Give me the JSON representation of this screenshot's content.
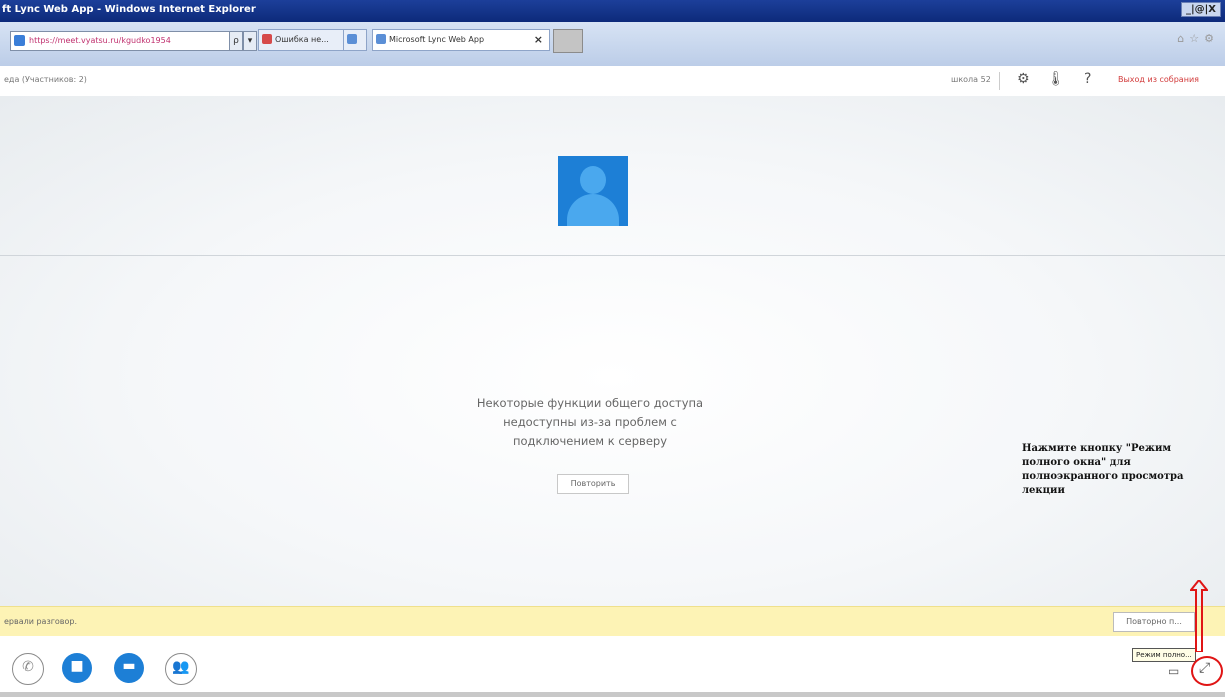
{
  "window": {
    "title": "ft Lync Web App - Windows Internet Explorer",
    "controls": "_|@|X"
  },
  "browser": {
    "address_text": "https://meet.vyatsu.ru/kgudko1954",
    "search_glyph": "ρ",
    "dropdown_glyph": "▾",
    "tabs": [
      {
        "label": "Ошибка не...",
        "active": false
      },
      {
        "label": "",
        "active": false
      },
      {
        "label": "Microsoft Lync Web App",
        "active": true,
        "close": "×"
      }
    ],
    "right_icons": "⌂☆⚙"
  },
  "appbar": {
    "participants": "еда (Участников: 2)",
    "user": "школа 52",
    "settings_glyph": "⚙",
    "thermo_glyph": "🌡",
    "help": "?",
    "leave": "Выход из собрания"
  },
  "stage": {
    "message_line1": "Некоторые функции общего доступа",
    "message_line2": "недоступны из-за проблем с",
    "message_line3": "подключением к серверу",
    "retry": "Повторить"
  },
  "annotation": "Нажмите кнопку \"Режим полного окна\" для полноэкранного просмотра лекции",
  "notification": {
    "text": "ервали разговор.",
    "button": "Повторно п..."
  },
  "controls": {
    "phone_glyph": "✆",
    "video_glyph": "■",
    "screen_glyph": "▬",
    "people_glyph": "👥",
    "tooltip": "Режим полно...",
    "fullscreen_glyph": "⤢"
  },
  "colors": {
    "accent": "#1d7fd6",
    "annotation_red": "#e01515",
    "notify_bg": "#fdf3b5",
    "leave_link": "#d23b3b"
  }
}
